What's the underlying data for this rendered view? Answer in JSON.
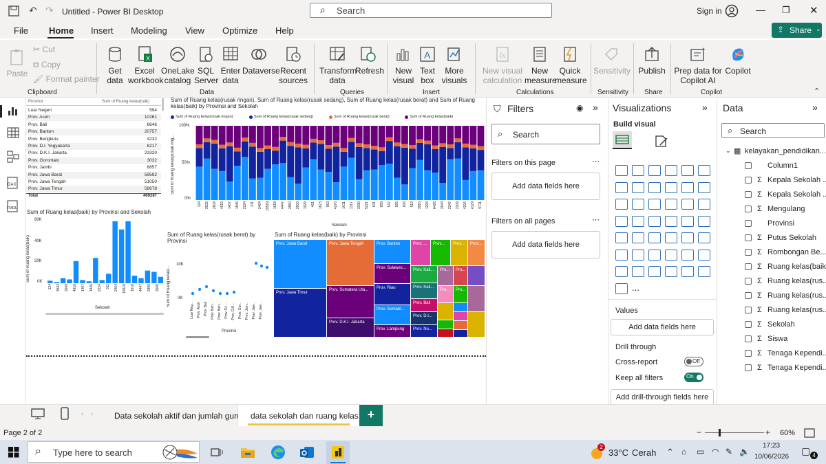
{
  "window": {
    "title": "Untitled - Power BI Desktop",
    "search_placeholder": "Search",
    "sign_in": "Sign in"
  },
  "menu": {
    "items": [
      "File",
      "Home",
      "Insert",
      "Modeling",
      "View",
      "Optimize",
      "Help"
    ],
    "share": "Share"
  },
  "ribbon": {
    "clipboard": {
      "paste": "Paste",
      "cut": "Cut",
      "copy": "Copy",
      "format_painter": "Format painter",
      "group": "Clipboard"
    },
    "data": {
      "get_data": "Get data",
      "excel": "Excel workbook",
      "onelake": "OneLake catalog",
      "sql": "SQL Server",
      "enter": "Enter data",
      "dataverse": "Dataverse",
      "recent": "Recent sources",
      "group": "Data"
    },
    "queries": {
      "transform": "Transform data",
      "refresh": "Refresh",
      "group": "Queries"
    },
    "insert": {
      "new_visual": "New visual",
      "text_box": "Text box",
      "more_visuals": "More visuals",
      "group": "Insert"
    },
    "calculations": {
      "new_visual_calc": "New visual calculation",
      "new_measure": "New measure",
      "quick_measure": "Quick measure",
      "group": "Calculations"
    },
    "sensitivity": {
      "label": "Sensitivity",
      "group": "Sensitivity"
    },
    "share": {
      "publish": "Publish",
      "group": "Share"
    },
    "copilot": {
      "prep": "Prep data for Copilot AI",
      "copilot": "Copilot",
      "group": "Copilot"
    }
  },
  "table_visual": {
    "headers": [
      "Provinsi",
      "Sum of Ruang kelas(baik)"
    ],
    "rows": [
      [
        "Luar Negeri",
        "594"
      ],
      [
        "Prov. Aceh",
        "10261"
      ],
      [
        "Prov. Bali",
        "8646"
      ],
      [
        "Prov. Banten",
        "20757"
      ],
      [
        "Prov. Bengkulu",
        "4232"
      ],
      [
        "Prov. D.I. Yogyakarta",
        "8217"
      ],
      [
        "Prov. D.K.I. Jakarta",
        "23320"
      ],
      [
        "Prov. Gorontalo",
        "3032"
      ],
      [
        "Prov. Jambi",
        "6857"
      ],
      [
        "Prov. Jawa Barat",
        "59592"
      ],
      [
        "Prov. Jawa Tengah",
        "51050"
      ],
      [
        "Prov. Jawa Timur",
        "58678"
      ]
    ],
    "total_label": "Total",
    "total_value": "469287"
  },
  "stacked_chart": {
    "title": "Sum of Ruang kelas(rusak ringan), Sum of Ruang kelas(rusak sedang), Sum of Ruang kelas(rusak berat) and Sum of Ruang kelas(baik) by Provinsi and Sekolah",
    "legend": [
      "Sum of Ruang kelas(rusak ringan)",
      "Sum of Ruang kelas(rusak sedang)",
      "Sum of Ruang kelas(rusak berat)",
      "Sum of Ruang kelas(baik)"
    ],
    "colors": [
      "#12239e",
      "#e66c37",
      "#6b007b",
      "#118dff"
    ],
    "y_label": "Sum of Ruang kelas(rusak ring...",
    "y_ticks": [
      "100%",
      "50%",
      "0%"
    ],
    "x_label": "Sekolah",
    "x_ticks": [
      "124",
      "3532",
      "2609",
      "4619",
      "1407",
      "1846",
      "2224",
      "311",
      "2464",
      "19519",
      "1618",
      "4447",
      "2850",
      "2600",
      "1929",
      "461",
      "1673",
      "962",
      "4276",
      "1611",
      "1317",
      "3330",
      "5221",
      "631",
      "859",
      "547",
      "565",
      "606",
      "513",
      "3815",
      "1293",
      "6428",
      "2644",
      "2347",
      "2209",
      "4206",
      "4179",
      "9711"
    ]
  },
  "bar_chart": {
    "title": "Sum of Ruang kelas(baik) by Provinsi and Sekolah",
    "y_label": "Sum of Ruang kelas(baik)",
    "y_ticks": [
      "60K",
      "40K",
      "20K",
      "0K"
    ],
    "x_label": "Sekolah",
    "x_ticks": [
      "124",
      "3532",
      "2609",
      "4619",
      "1407",
      "1846",
      "2224",
      "311",
      "2464",
      "19519",
      "1618",
      "4447",
      "2850",
      "2600"
    ]
  },
  "scatter_chart": {
    "title": "Sum of Ruang kelas(rusak berat) by Provinsi",
    "y_label": "Sum of Ruang kelasr...",
    "y_ticks": [
      "10K",
      "0K"
    ],
    "x_label": "Provinsi",
    "x_ticks": [
      "Luar Neg...",
      "Prov. Aceh",
      "Prov. Bali",
      "Prov. Ban...",
      "Prov. Ben...",
      "Prov. D.I....",
      "Prov. D.K....",
      "Prov. Gor...",
      "Prov. Jam...",
      "Prov. Jaw...",
      "Prov. Jaw..."
    ]
  },
  "treemap": {
    "title": "Sum of Ruang kelas(baik) by Provinsi",
    "labels": [
      "Prov. Jawa Barat",
      "Prov. Jawa Tengah",
      "Prov. Banten",
      "Prov. ...",
      "Prov...",
      "Prov...",
      "Prov...",
      "Prov. Sulawes...",
      "Prov. Kali...",
      "Pro...",
      "Pro...",
      "Prov. Jawa Timur",
      "Prov. Sumatera Uta...",
      "Prov. Riau",
      "Prov. Kali...",
      "Pro...",
      "Pro...",
      "Prov. Bali",
      "Prov. Sumate...",
      "Prov. D.K.I. Jakarta",
      "Prov. Lampung",
      "Prov. D.I...",
      "Prov. Nu..."
    ]
  },
  "filters": {
    "title": "Filters",
    "search": "Search",
    "on_page": "Filters on this page",
    "on_all": "Filters on all pages",
    "add": "Add data fields here"
  },
  "visualizations": {
    "title": "Visualizations",
    "build": "Build visual",
    "values": "Values",
    "add_values": "Add data fields here",
    "drill": "Drill through",
    "cross": "Cross-report",
    "cross_state": "Off",
    "keep": "Keep all filters",
    "keep_state": "On",
    "add_drill": "Add drill-through fields here",
    "more": "..."
  },
  "data": {
    "title": "Data",
    "search": "Search",
    "table": "kelayakan_pendidikan...",
    "fields": [
      {
        "sigma": "",
        "name": "Column1"
      },
      {
        "sigma": "Σ",
        "name": "Kepala Sekolah ..."
      },
      {
        "sigma": "Σ",
        "name": "Kepala Sekolah ..."
      },
      {
        "sigma": "Σ",
        "name": "Mengulang"
      },
      {
        "sigma": "",
        "name": "Provinsi"
      },
      {
        "sigma": "Σ",
        "name": "Putus Sekolah"
      },
      {
        "sigma": "Σ",
        "name": "Rombongan Be..."
      },
      {
        "sigma": "Σ",
        "name": "Ruang kelas(baik)"
      },
      {
        "sigma": "Σ",
        "name": "Ruang kelas(rus..."
      },
      {
        "sigma": "Σ",
        "name": "Ruang kelas(rus..."
      },
      {
        "sigma": "Σ",
        "name": "Ruang kelas(rus..."
      },
      {
        "sigma": "Σ",
        "name": "Sekolah"
      },
      {
        "sigma": "Σ",
        "name": "Siswa"
      },
      {
        "sigma": "Σ",
        "name": "Tenaga Kependi..."
      },
      {
        "sigma": "Σ",
        "name": "Tenaga Kependi..."
      }
    ]
  },
  "tabs": {
    "items": [
      "Data sekolah aktif dan jumlah guru",
      "data sekolah dan ruang kelas"
    ],
    "add": "+"
  },
  "status": {
    "page": "Page 2 of 2",
    "zoom": "60%"
  },
  "taskbar": {
    "search": "Type here to search",
    "weather_badge": "2",
    "temp": "33°C",
    "weather": "Cerah",
    "time": "17:23",
    "date": "10/06/2026",
    "notif": "4"
  }
}
